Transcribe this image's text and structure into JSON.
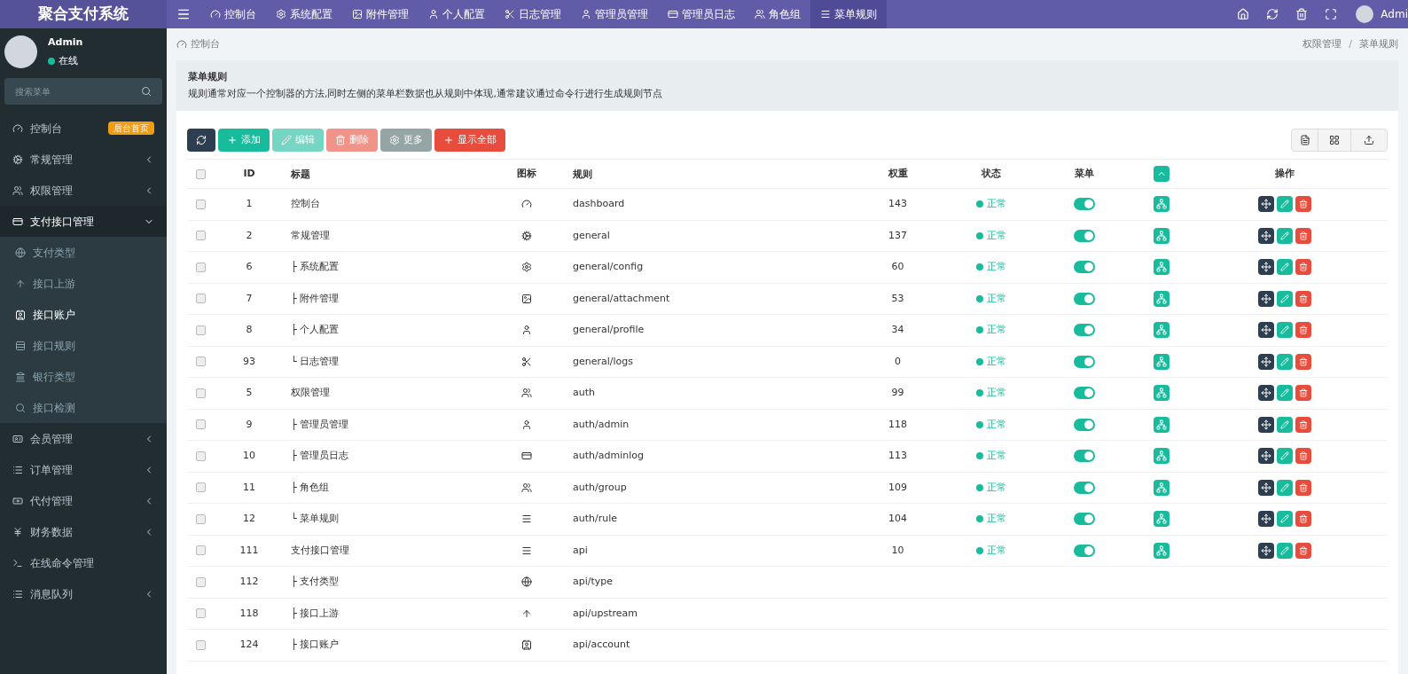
{
  "logo": "聚合支付系统",
  "top_nav": [
    {
      "label": "控制台",
      "selected": false
    },
    {
      "label": "系统配置",
      "selected": false
    },
    {
      "label": "附件管理",
      "selected": false
    },
    {
      "label": "个人配置",
      "selected": false
    },
    {
      "label": "日志管理",
      "selected": false
    },
    {
      "label": "管理员管理",
      "selected": false
    },
    {
      "label": "管理员日志",
      "selected": false
    },
    {
      "label": "角色组",
      "selected": false
    },
    {
      "label": "菜单规则",
      "selected": true
    }
  ],
  "top_user": "Admi",
  "user": {
    "name": "Admin",
    "status": "在线"
  },
  "sidebar_search": {
    "placeholder": "搜索菜单"
  },
  "sidebar": {
    "items": [
      {
        "label": "控制台",
        "badge": "后台首页"
      },
      {
        "label": "常规管理",
        "expanded": false
      },
      {
        "label": "权限管理",
        "expanded": false
      },
      {
        "label": "支付接口管理",
        "expanded": true,
        "children": [
          {
            "label": "支付类型",
            "selected": false
          },
          {
            "label": "接口上游",
            "selected": false
          },
          {
            "label": "接口账户",
            "selected": true
          },
          {
            "label": "接口规则",
            "selected": false
          },
          {
            "label": "银行类型",
            "selected": false
          },
          {
            "label": "接口检测",
            "selected": false
          }
        ]
      },
      {
        "label": "会员管理",
        "expanded": false
      },
      {
        "label": "订单管理",
        "expanded": false
      },
      {
        "label": "代付管理",
        "expanded": false
      },
      {
        "label": "财务数据",
        "expanded": false
      },
      {
        "label": "在线命令管理"
      },
      {
        "label": "消息队列",
        "expanded": false
      }
    ]
  },
  "breadcrumb_home": "控制台",
  "breadcrumb": [
    "权限管理",
    "菜单规则"
  ],
  "breadcrumb_separator": "/",
  "panel": {
    "title": "菜单规则",
    "description": "规则通常对应一个控制器的方法,同时左侧的菜单栏数据也从规则中体现,通常建议通过命令行进行生成规则节点"
  },
  "toolbar": [
    {
      "kind": "refresh",
      "disabled": false
    },
    {
      "kind": "add",
      "label": "添加",
      "disabled": false
    },
    {
      "kind": "edit",
      "label": "编辑",
      "disabled": true
    },
    {
      "kind": "delete",
      "label": "删除",
      "disabled": true
    },
    {
      "kind": "more",
      "label": "更多",
      "disabled": false
    },
    {
      "kind": "showall",
      "label": "显示全部",
      "disabled": false
    }
  ],
  "table": {
    "select_all": false,
    "columns": [
      "ID",
      "标题",
      "图标",
      "规则",
      "权重",
      "状态",
      "菜单",
      "操作"
    ],
    "rows": [
      {
        "checked": false,
        "id": "1",
        "title": "控制台",
        "rule": "dashboard",
        "weight": "143",
        "status": "正常",
        "menu": true
      },
      {
        "checked": false,
        "id": "2",
        "title": "常规管理",
        "rule": "general",
        "weight": "137",
        "status": "正常",
        "menu": true
      },
      {
        "checked": false,
        "id": "6",
        "title": "├ 系统配置",
        "rule": "general/config",
        "weight": "60",
        "status": "正常",
        "menu": true
      },
      {
        "checked": false,
        "id": "7",
        "title": "├ 附件管理",
        "rule": "general/attachment",
        "weight": "53",
        "status": "正常",
        "menu": true
      },
      {
        "checked": false,
        "id": "8",
        "title": "├ 个人配置",
        "rule": "general/profile",
        "weight": "34",
        "status": "正常",
        "menu": true
      },
      {
        "checked": false,
        "id": "93",
        "title": "└ 日志管理",
        "rule": "general/logs",
        "weight": "0",
        "status": "正常",
        "menu": true
      },
      {
        "checked": false,
        "id": "5",
        "title": "权限管理",
        "rule": "auth",
        "weight": "99",
        "status": "正常",
        "menu": true
      },
      {
        "checked": false,
        "id": "9",
        "title": "├ 管理员管理",
        "rule": "auth/admin",
        "weight": "118",
        "status": "正常",
        "menu": true
      },
      {
        "checked": false,
        "id": "10",
        "title": "├ 管理员日志",
        "rule": "auth/adminlog",
        "weight": "113",
        "status": "正常",
        "menu": true
      },
      {
        "checked": false,
        "id": "11",
        "title": "├ 角色组",
        "rule": "auth/group",
        "weight": "109",
        "status": "正常",
        "menu": true
      },
      {
        "checked": false,
        "id": "12",
        "title": "└ 菜单规则",
        "rule": "auth/rule",
        "weight": "104",
        "status": "正常",
        "menu": true
      },
      {
        "checked": false,
        "id": "111",
        "title": "支付接口管理",
        "rule": "api",
        "weight": "10",
        "status": "正常",
        "menu": true
      },
      {
        "checked": false,
        "id": "112",
        "title": "├ 支付类型",
        "rule": "api/type"
      },
      {
        "checked": false,
        "id": "118",
        "title": "├ 接口上游",
        "rule": "api/upstream"
      },
      {
        "checked": false,
        "id": "124",
        "title": "├ 接口账户",
        "rule": "api/account"
      }
    ]
  }
}
